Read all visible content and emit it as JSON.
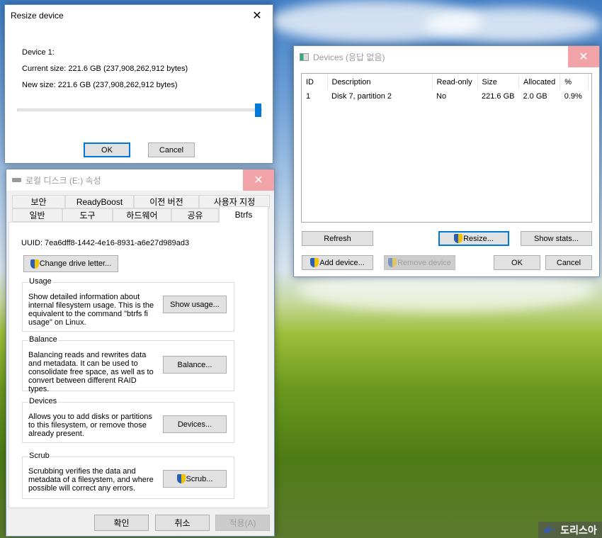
{
  "resize_dialog": {
    "title": "Resize device",
    "device_label": "Device 1:",
    "current_size": "Current size: 221.6 GB (237,908,262,912 bytes)",
    "new_size": "New size: 221.6 GB (237,908,262,912 bytes)",
    "slider_percent": 100,
    "ok": "OK",
    "cancel": "Cancel"
  },
  "devices_dialog": {
    "title": "Devices (응답 없음)",
    "columns": [
      "ID",
      "Description",
      "Read-only",
      "Size",
      "Allocated",
      "%"
    ],
    "rows": [
      [
        "1",
        "Disk 7, partition 2",
        "No",
        "221.6 GB",
        "2.0 GB",
        "0.9%"
      ]
    ],
    "refresh": "Refresh",
    "resize": "Resize...",
    "show_stats": "Show stats...",
    "add_device": "Add device...",
    "remove_device": "Remove device",
    "ok": "OK",
    "cancel": "Cancel"
  },
  "properties": {
    "title": "로컬 디스크 (E:) 속성",
    "tabs_top": [
      "보안",
      "ReadyBoost",
      "이전 버전",
      "사용자 지정"
    ],
    "tabs_bottom": [
      "일반",
      "도구",
      "하드웨어",
      "공유",
      "Btrfs"
    ],
    "uuid_label": "UUID:",
    "uuid": "7ea6dff8-1442-4e16-8931-a6e27d989ad3",
    "change_letter": "Change drive letter...",
    "groups": [
      {
        "label": "Usage",
        "desc": "Show detailed information about internal filesystem usage. This is the equivalent to the command \"btrfs fi usage\" on Linux.",
        "button": "Show usage..."
      },
      {
        "label": "Balance",
        "desc": "Balancing reads and rewrites data and metadata. It can be used to consolidate free space, as well as to convert between different RAID types.",
        "button": "Balance..."
      },
      {
        "label": "Devices",
        "desc": "Allows you to add disks or partitions to this filesystem, or remove those already present.",
        "button": "Devices..."
      },
      {
        "label": "Scrub",
        "desc": "Scrubbing verifies the data and metadata of a filesystem, and where possible will correct any errors.",
        "button": "Scrub..."
      }
    ],
    "ok": "확인",
    "cancel": "취소",
    "apply": "적용(A)"
  },
  "watermark": "도리스아"
}
